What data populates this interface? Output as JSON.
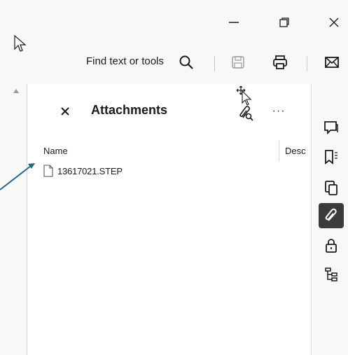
{
  "window": {
    "minimize_icon": "minimize-icon",
    "restore_icon": "restore-icon",
    "close_icon": "close-icon"
  },
  "toolbar": {
    "find_label": "Find text or tools",
    "icons": [
      "search-icon",
      "save-icon",
      "print-icon",
      "mail-icon"
    ]
  },
  "panel": {
    "title": "Attachments",
    "more_label": "···",
    "columns": {
      "name": "Name",
      "description": "Desc"
    },
    "files": [
      {
        "name": "13617021.STEP"
      }
    ]
  },
  "right_rail": {
    "items": [
      "comment-icon",
      "bookmark-icon",
      "pages-icon",
      "attachment-icon",
      "lock-icon",
      "tree-icon"
    ],
    "active": "attachment-icon"
  },
  "colors": {
    "background": "#f8f8f8",
    "panel": "#ffffff",
    "active_rail": "#3b3b3b",
    "annotation_arrow": "#1f6b8a"
  }
}
